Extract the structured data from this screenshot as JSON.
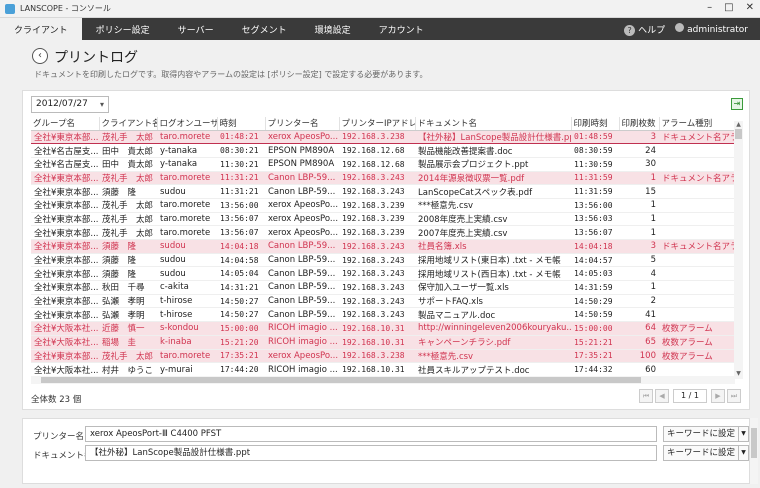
{
  "window": {
    "title": "LANSCOPE - コンソール"
  },
  "menu": {
    "tabs": [
      {
        "label": "クライアント",
        "active": true
      },
      {
        "label": "ポリシー設定",
        "active": false
      },
      {
        "label": "サーバー",
        "active": false
      },
      {
        "label": "セグメント",
        "active": false
      },
      {
        "label": "環境設定",
        "active": false
      },
      {
        "label": "アカウント",
        "active": false
      }
    ],
    "help_label": "ヘルプ",
    "user_label": "administrator"
  },
  "page": {
    "title": "プリントログ",
    "description": "ドキュメントを印刷したログです。取得内容やアラームの設定は [ポリシー設定] で設定する必要があります。"
  },
  "filter": {
    "date": "2012/07/27"
  },
  "table": {
    "columns": [
      "グループ名",
      "クライアント名",
      "ログオンユーザ...",
      "時刻",
      "プリンター名",
      "プリンターIPアドレス",
      "ドキュメント名",
      "印刷時刻",
      "印刷枚数",
      "アラーム種別"
    ],
    "rows": [
      {
        "alarm": true,
        "selected": true,
        "cells": [
          "全社¥東京本部...",
          "茂礼手　太郎",
          "taro.morete",
          "01:48:21",
          "xerox ApeosPo...",
          "192.168.3.238",
          "【社外秘】LanScope製品設計仕様書.ppt",
          "01:48:59",
          "3",
          "ドキュメント名アラーム"
        ]
      },
      {
        "alarm": false,
        "selected": false,
        "cells": [
          "全社¥名古屋支...",
          "田中　貴太郎",
          "y-tanaka",
          "08:30:21",
          "EPSON PM890A",
          "192.168.12.68",
          "製品機能改善提案書.doc",
          "08:30:59",
          "24",
          ""
        ]
      },
      {
        "alarm": false,
        "selected": false,
        "cells": [
          "全社¥名古屋支...",
          "田中　貴太郎",
          "y-tanaka",
          "11:30:21",
          "EPSON PM890A",
          "192.168.12.68",
          "製品展示会プロジェクト.ppt",
          "11:30:59",
          "30",
          ""
        ]
      },
      {
        "alarm": true,
        "selected": false,
        "cells": [
          "全社¥東京本部...",
          "茂礼手　太郎",
          "taro.morete",
          "11:31:21",
          "Canon LBP-59...",
          "192.168.3.243",
          "2014年源泉徴収票一覧.pdf",
          "11:31:59",
          "1",
          "ドキュメント名アラーム"
        ]
      },
      {
        "alarm": false,
        "selected": false,
        "cells": [
          "全社¥東京本部...",
          "須藤　隆",
          "sudou",
          "11:31:21",
          "Canon LBP-59...",
          "192.168.3.243",
          "LanScopeCatスペック表.pdf",
          "11:31:59",
          "15",
          ""
        ]
      },
      {
        "alarm": false,
        "selected": false,
        "cells": [
          "全社¥東京本部...",
          "茂礼手　太郎",
          "taro.morete",
          "13:56:00",
          "xerox ApeosPo...",
          "192.168.3.239",
          "***極意先.csv",
          "13:56:00",
          "1",
          ""
        ]
      },
      {
        "alarm": false,
        "selected": false,
        "cells": [
          "全社¥東京本部...",
          "茂礼手　太郎",
          "taro.morete",
          "13:56:07",
          "xerox ApeosPo...",
          "192.168.3.239",
          "2008年度売上実績.csv",
          "13:56:03",
          "1",
          ""
        ]
      },
      {
        "alarm": false,
        "selected": false,
        "cells": [
          "全社¥東京本部...",
          "茂礼手　太郎",
          "taro.morete",
          "13:56:07",
          "xerox ApeosPo...",
          "192.168.3.239",
          "2007年度売上実績.csv",
          "13:56:07",
          "1",
          ""
        ]
      },
      {
        "alarm": true,
        "selected": false,
        "cells": [
          "全社¥東京本部...",
          "須藤　隆",
          "sudou",
          "14:04:18",
          "Canon LBP-59...",
          "192.168.3.243",
          "社員名簿.xls",
          "14:04:18",
          "3",
          "ドキュメント名アラーム"
        ]
      },
      {
        "alarm": false,
        "selected": false,
        "cells": [
          "全社¥東京本部...",
          "須藤　隆",
          "sudou",
          "14:04:58",
          "Canon LBP-59...",
          "192.168.3.243",
          "採用地域リスト(東日本) .txt - メモ帳",
          "14:04:57",
          "5",
          ""
        ]
      },
      {
        "alarm": false,
        "selected": false,
        "cells": [
          "全社¥東京本部...",
          "須藤　隆",
          "sudou",
          "14:05:04",
          "Canon LBP-59...",
          "192.168.3.243",
          "採用地域リスト(西日本) .txt - メモ帳",
          "14:05:03",
          "4",
          ""
        ]
      },
      {
        "alarm": false,
        "selected": false,
        "cells": [
          "全社¥東京本部...",
          "秋田　千尋",
          "c-akita",
          "14:31:21",
          "Canon LBP-59...",
          "192.168.3.243",
          "保守加入ユーザ一覧.xls",
          "14:31:59",
          "1",
          ""
        ]
      },
      {
        "alarm": false,
        "selected": false,
        "cells": [
          "全社¥東京本部...",
          "弘瀬　孝明",
          "t-hirose",
          "14:50:27",
          "Canon LBP-59...",
          "192.168.3.243",
          "サポートFAQ.xls",
          "14:50:29",
          "2",
          ""
        ]
      },
      {
        "alarm": false,
        "selected": false,
        "cells": [
          "全社¥東京本部...",
          "弘瀬　孝明",
          "t-hirose",
          "14:50:27",
          "Canon LBP-59...",
          "192.168.3.243",
          "製品マニュアル.doc",
          "14:50:59",
          "41",
          ""
        ]
      },
      {
        "alarm": true,
        "selected": false,
        "cells": [
          "全社¥大阪本社...",
          "近藤　慎一",
          "s-kondou",
          "15:00:00",
          "RICOH imagio ...",
          "192.168.10.31",
          "http://winningeleven2006kouryaku...",
          "15:00:00",
          "64",
          "枚数アラーム"
        ]
      },
      {
        "alarm": true,
        "selected": false,
        "cells": [
          "全社¥大阪本社...",
          "稲場　圭",
          "k-inaba",
          "15:21:20",
          "RICOH imagio ...",
          "192.168.10.31",
          "キャンペーンチラシ.pdf",
          "15:21:21",
          "65",
          "枚数アラーム"
        ]
      },
      {
        "alarm": true,
        "selected": false,
        "cells": [
          "全社¥東京本部...",
          "茂礼手　太郎",
          "taro.morete",
          "17:35:21",
          "xerox ApeosPo...",
          "192.168.3.238",
          "***極意先.csv",
          "17:35:21",
          "100",
          "枚数アラーム"
        ]
      },
      {
        "alarm": false,
        "selected": false,
        "cells": [
          "全社¥大阪本社...",
          "村井　ゆうこ",
          "y-murai",
          "17:44:20",
          "RICOH imagio ...",
          "192.168.10.31",
          "社員スキルアップテスト.doc",
          "17:44:32",
          "60",
          ""
        ]
      }
    ]
  },
  "footer": {
    "total_label": "全体数 23 個",
    "page_info": "1 / 1"
  },
  "details": {
    "printer_label": "プリンター名:",
    "printer_value": "xerox ApeosPort-Ⅲ C4400 PFST",
    "document_label": "ドキュメント名:",
    "document_value": "【社外秘】LanScope製品設計仕様書.ppt",
    "keyword_button": "キーワードに設定"
  },
  "colors": {
    "alarm_text": "#d0334f",
    "alarm_bg": "#f8e1e5",
    "menubar_bg": "#3a3a3a"
  }
}
